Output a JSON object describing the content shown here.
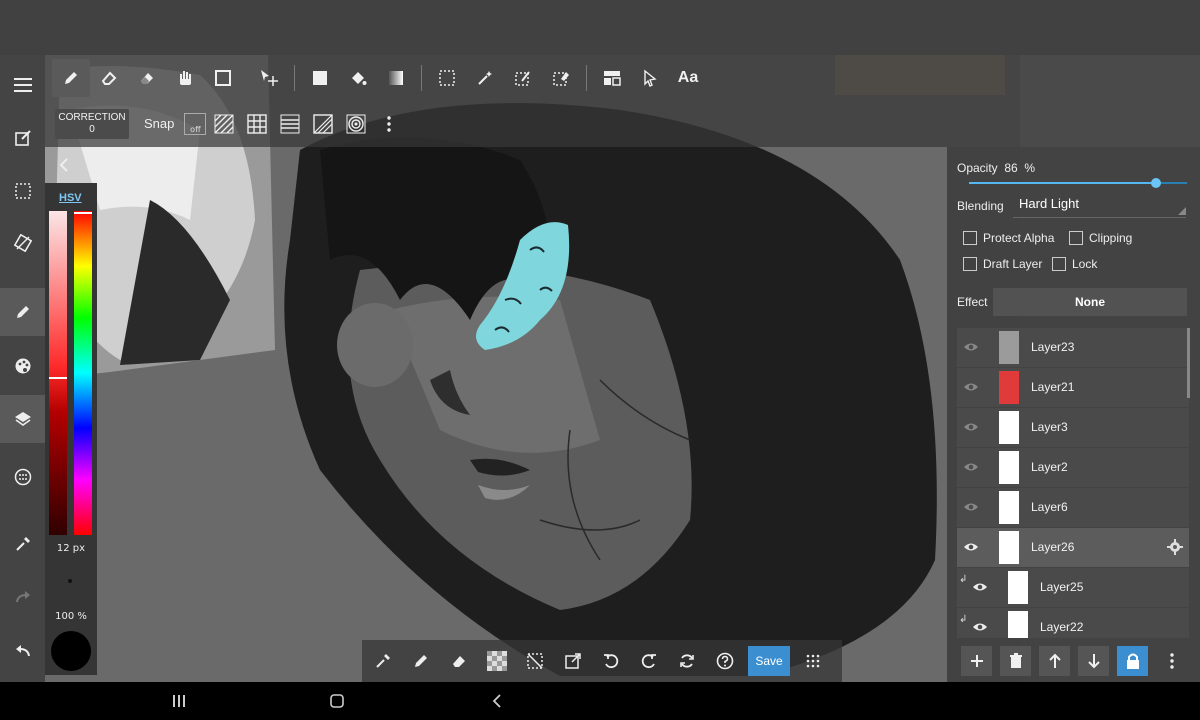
{
  "toolbar": {
    "correction_label": "CORRECTION",
    "correction_value": "0",
    "snap_label": "Snap",
    "snap_state": "off",
    "text_tool_label": "Aa",
    "tools": [
      "pen-icon",
      "eraser-icon",
      "blur-eraser-icon",
      "hand-icon",
      "rectangle-icon",
      "move-icon",
      "fill-square-icon",
      "bucket-icon",
      "gradient-icon",
      "select-rect-icon",
      "magic-wand-icon",
      "select-pen-icon",
      "select-eraser-icon",
      "layout-icon",
      "pointer-icon"
    ]
  },
  "color_panel": {
    "mode_label": "HSV",
    "brush_size": "12 px",
    "brush_opacity": "100 %",
    "current_color": "#000000"
  },
  "layer_panel": {
    "opacity_label": "Opacity",
    "opacity_value": "86",
    "opacity_unit": "%",
    "opacity_fraction": 0.86,
    "blending_label": "Blending",
    "blending_value": "Hard Light",
    "protect_alpha": "Protect Alpha",
    "clipping": "Clipping",
    "draft_layer": "Draft Layer",
    "lock": "Lock",
    "effect_label": "Effect",
    "effect_value": "None",
    "layers": [
      {
        "name": "Layer23",
        "thumb": "#9b9b9b"
      },
      {
        "name": "Layer21",
        "thumb": "#e03a3a"
      },
      {
        "name": "Layer3",
        "thumb": "#ffffff"
      },
      {
        "name": "Layer2",
        "thumb": "#ffffff"
      },
      {
        "name": "Layer6",
        "thumb": "#ffffff"
      },
      {
        "name": "Layer26",
        "thumb": "#ffffff"
      },
      {
        "name": "Layer25",
        "thumb": "#ffffff"
      },
      {
        "name": "Layer22",
        "thumb": "#ffffff"
      }
    ]
  },
  "bottom_toolbar": {
    "save_label": "Save"
  },
  "colors": {
    "accent": "#3b8fd0",
    "cyan_highlight": "#7fd6dc"
  }
}
